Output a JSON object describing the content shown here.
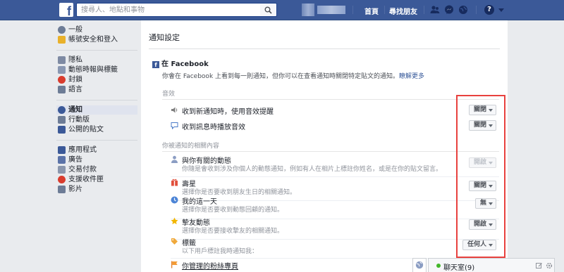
{
  "topbar": {
    "logo": "f",
    "search_placeholder": "搜尋人、地點和事物",
    "nav": [
      "首頁",
      "尋找朋友"
    ]
  },
  "sidebar": {
    "groups": [
      [
        {
          "label": "一般",
          "icon": "gear-icon",
          "color": "#6d7c96"
        },
        {
          "label": "帳號安全和登入",
          "icon": "shield-icon",
          "color": "#e9b12b"
        }
      ],
      [
        {
          "label": "隱私",
          "icon": "lock-icon",
          "color": "#7e8aa3"
        },
        {
          "label": "動態時報與標籤",
          "icon": "timeline-icon",
          "color": "#8997b2"
        },
        {
          "label": "封鎖",
          "icon": "block-icon",
          "color": "#d93c2e"
        },
        {
          "label": "語言",
          "icon": "language-icon",
          "color": "#6d7c96"
        }
      ],
      [
        {
          "label": "通知",
          "icon": "globe-icon",
          "color": "#3b5998",
          "active": true
        },
        {
          "label": "行動版",
          "icon": "mobile-icon",
          "color": "#6d7c96"
        },
        {
          "label": "公開的貼文",
          "icon": "rss-icon",
          "color": "#3b5998"
        }
      ],
      [
        {
          "label": "應用程式",
          "icon": "apps-icon",
          "color": "#3b5998"
        },
        {
          "label": "廣告",
          "icon": "ads-icon",
          "color": "#5b73a8"
        },
        {
          "label": "交易付款",
          "icon": "payment-icon",
          "color": "#8a96ad"
        },
        {
          "label": "支援收件匣",
          "icon": "support-icon",
          "color": "#d93c2e"
        },
        {
          "label": "影片",
          "icon": "video-icon",
          "color": "#6d7c96"
        }
      ]
    ]
  },
  "main": {
    "title": "通知設定",
    "section_title": "在 Facebook",
    "section_desc": "你會在 Facebook 上看到每一則通知，但你可以在查看通知時關閉特定貼文的通知。",
    "learn_more": "瞭解更多",
    "sound_label": "音效",
    "sound_rows": [
      {
        "title": "收到新通知時，使用音效提醒",
        "value": "關閉",
        "icon": "speaker-icon"
      },
      {
        "title": "收到訊息時播放音效",
        "value": "關閉",
        "icon": "chat-bubble-icon"
      }
    ],
    "related_label": "你被通知的相關內容",
    "related_rows": [
      {
        "title": "與你有關的動態",
        "sub": "你隨是會收到涉及你個人的動態通知，例如有人在相片上標註你姓名，或是在你的貼文留言。",
        "value": "開啟",
        "disabled": true,
        "icon": "person-icon"
      },
      {
        "title": "壽星",
        "sub": "選擇你是否要收到朋友生日的相關通知。",
        "value": "關閉",
        "icon": "gift-icon"
      },
      {
        "title": "我的這一天",
        "sub": "選擇你是否要收到動態回顧的通知。",
        "value": "無",
        "icon": "memories-icon"
      },
      {
        "title": "摯友動態",
        "sub": "選擇你是否要接收摯友的相關通知。",
        "value": "開啟",
        "icon": "star-icon"
      },
      {
        "title": "標籤",
        "sub": "以下用戶標註我時通知我：",
        "value": "任何人",
        "icon": "tag-icon"
      }
    ],
    "pages_row": "你管理的粉絲專頁"
  },
  "chat": {
    "label": "聊天室(9)"
  }
}
